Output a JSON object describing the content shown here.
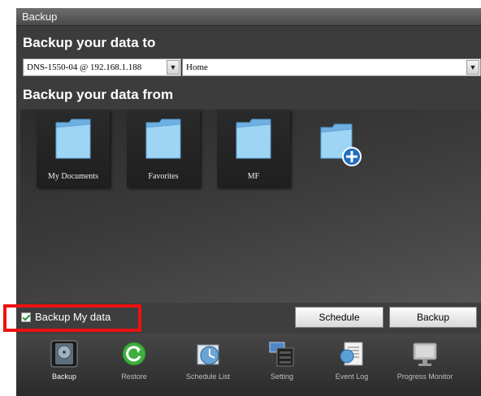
{
  "window": {
    "title": "Backup"
  },
  "destination": {
    "heading": "Backup your data to",
    "device": "DNS-1550-04 @ 192.168.1.188",
    "share": "Home"
  },
  "source": {
    "heading": "Backup your data from",
    "items": [
      {
        "label": "My Documents",
        "icon": "folder-icon"
      },
      {
        "label": "Favorites",
        "icon": "folder-icon"
      },
      {
        "label": "MF",
        "icon": "folder-icon"
      },
      {
        "label": "",
        "icon": "add-folder-icon"
      }
    ]
  },
  "controls": {
    "checkbox_label": "Backup My data",
    "checkbox_checked": true,
    "schedule_label": "Schedule",
    "backup_label": "Backup"
  },
  "dock": {
    "items": [
      {
        "label": "Backup",
        "icon": "backup-drive-icon"
      },
      {
        "label": "Restore",
        "icon": "restore-icon"
      },
      {
        "label": "Schedule List",
        "icon": "schedule-clock-icon"
      },
      {
        "label": "Setting",
        "icon": "setting-icon"
      },
      {
        "label": "Event Log",
        "icon": "event-log-icon"
      },
      {
        "label": "Progress Monitor",
        "icon": "monitor-icon"
      }
    ]
  },
  "colors": {
    "highlight": "#ee1111",
    "panel": "#3c3c3c",
    "folder": "#8ecbf0"
  }
}
